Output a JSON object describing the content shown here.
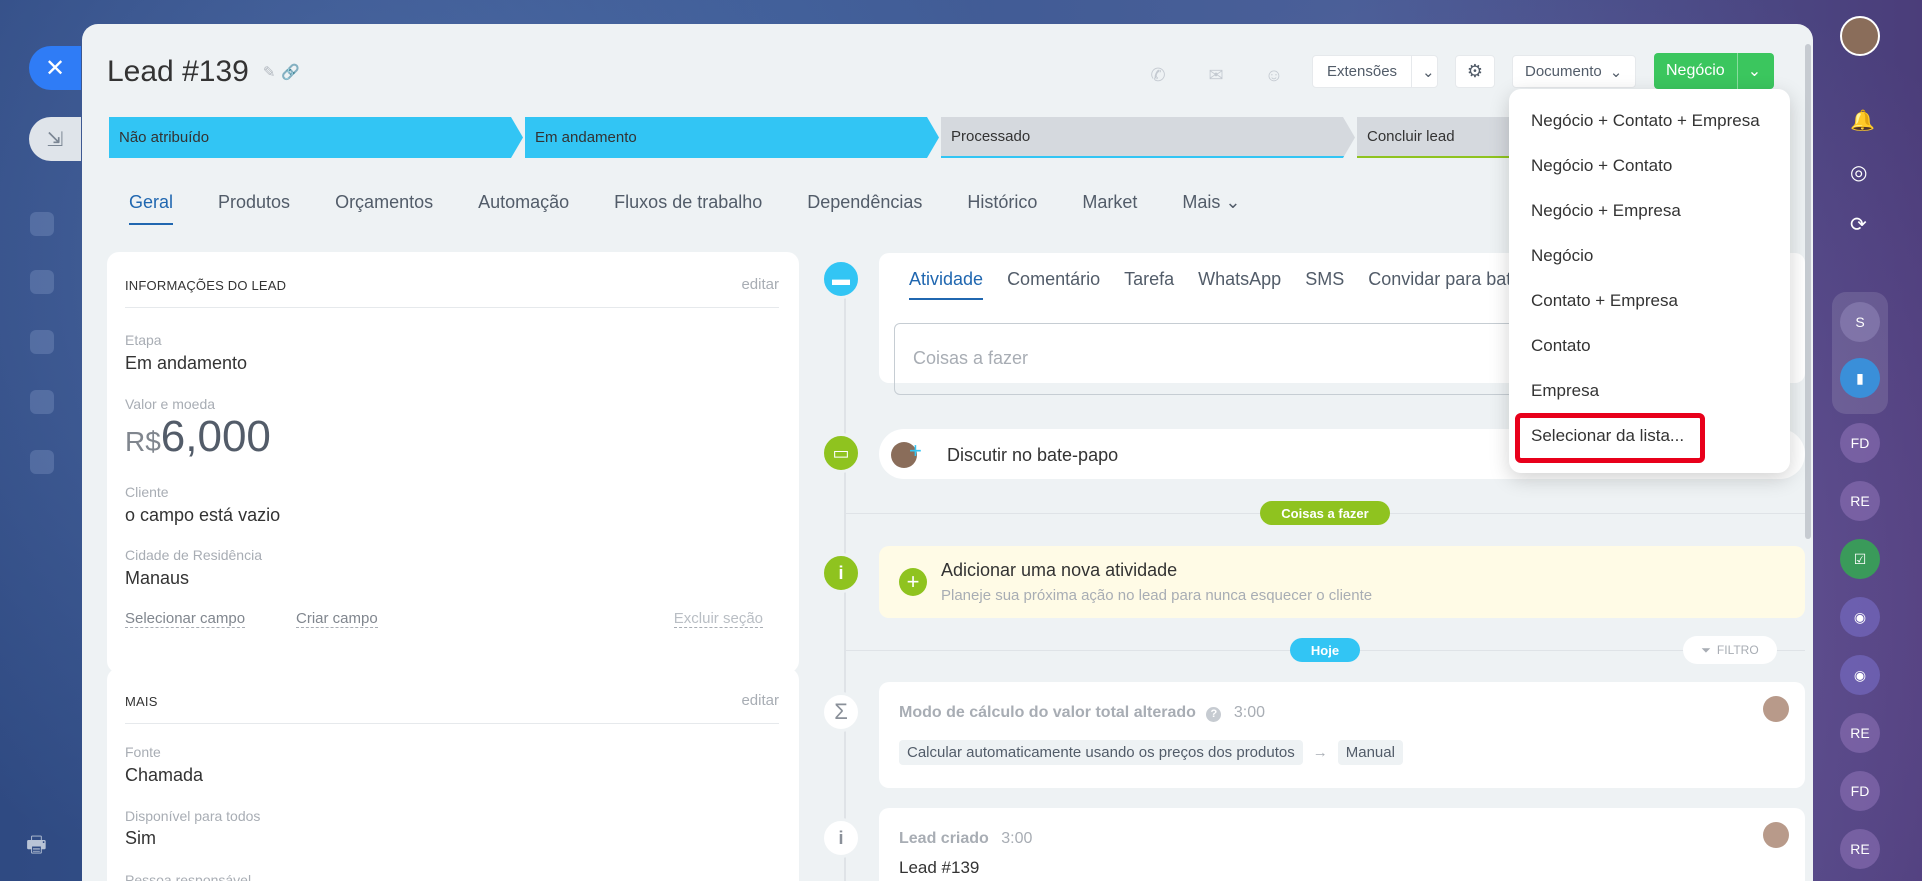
{
  "lead": {
    "title": "Lead #139"
  },
  "header": {
    "extensions_label": "Extensões",
    "document_label": "Documento",
    "deal_label": "Negócio"
  },
  "stages": [
    "Não atribuído",
    "Em andamento",
    "Processado",
    "Concluir lead"
  ],
  "tabs": [
    "Geral",
    "Produtos",
    "Orçamentos",
    "Automação",
    "Fluxos de trabalho",
    "Dependências",
    "Histórico",
    "Market",
    "Mais"
  ],
  "info_card": {
    "title": "INFORMAÇÕES DO LEAD",
    "edit": "editar",
    "stage_label": "Etapa",
    "stage_value": "Em andamento",
    "amount_label": "Valor e moeda",
    "currency": "R$",
    "amount": "6,000",
    "client_label": "Cliente",
    "client_value": "o campo está vazio",
    "city_label": "Cidade de Residência",
    "city_value": "Manaus",
    "select_field": "Selecionar campo",
    "create_field": "Criar campo",
    "delete_section": "Excluir seção"
  },
  "more_card": {
    "title": "MAIS",
    "edit": "editar",
    "source_label": "Fonte",
    "source_value": "Chamada",
    "available_label": "Disponível para todos",
    "available_value": "Sim",
    "responsible_label": "Pessoa responsável"
  },
  "activity_tabs": [
    "Atividade",
    "Comentário",
    "Tarefa",
    "WhatsApp",
    "SMS",
    "Convidar para bate-papo"
  ],
  "activity_input_placeholder": "Coisas a fazer",
  "discuss_label": "Discutir no bate-papo",
  "todo_pill": "Coisas a fazer",
  "add_activity": {
    "title": "Adicionar uma nova atividade",
    "subtitle": "Planeje sua próxima ação no lead para nunca esquecer o cliente"
  },
  "today_pill": "Hoje",
  "filter_label": "FILTRO",
  "calc_event": {
    "title": "Modo de cálculo do valor total alterado",
    "time": "3:00",
    "from": "Calcular automaticamente usando os preços dos produtos",
    "to": "Manual"
  },
  "created_event": {
    "title": "Lead criado",
    "time": "3:00",
    "body": "Lead #139"
  },
  "dropdown_items": [
    "Negócio + Contato + Empresa",
    "Negócio + Contato",
    "Negócio + Empresa",
    "Negócio",
    "Contato + Empresa",
    "Contato",
    "Empresa",
    "Selecionar da lista..."
  ],
  "rail_badges": [
    "S",
    "FD",
    "RE",
    "RE",
    "FD",
    "RE"
  ],
  "colors": {
    "accent_blue": "#32c5f4",
    "green": "#3bc65e",
    "lime": "#8fc31f",
    "highlight": "#e8001b"
  }
}
